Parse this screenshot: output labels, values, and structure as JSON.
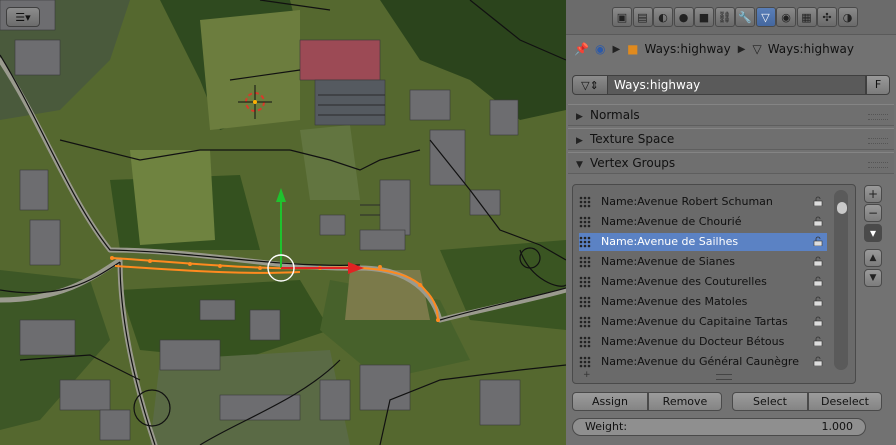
{
  "viewport": {
    "description_icons": [
      "3d-cursor-icon",
      "transform-gizmo-icon"
    ]
  },
  "properties": {
    "context_tabs": [
      {
        "name": "render-tab",
        "glyph": "▣"
      },
      {
        "name": "render-layers-tab",
        "glyph": "▤"
      },
      {
        "name": "scene-tab",
        "glyph": "◐"
      },
      {
        "name": "world-tab",
        "glyph": "●"
      },
      {
        "name": "object-tab",
        "glyph": "■"
      },
      {
        "name": "constraints-tab",
        "glyph": "⛓"
      },
      {
        "name": "modifiers-tab",
        "glyph": "🔧"
      },
      {
        "name": "data-tab",
        "glyph": "▽"
      },
      {
        "name": "material-tab",
        "glyph": "◉"
      },
      {
        "name": "texture-tab",
        "glyph": "▦"
      },
      {
        "name": "particles-tab",
        "glyph": "✣"
      },
      {
        "name": "physics-tab",
        "glyph": "◑"
      }
    ],
    "breadcrumb": {
      "object": "Ways:highway",
      "mesh": "Ways:highway"
    },
    "mesh_name": "Ways:highway",
    "fake_user": "F",
    "sections": {
      "normals": "Normals",
      "texture_space": "Texture Space",
      "vertex_groups": "Vertex Groups"
    },
    "vertex_groups": [
      "Name:Avenue Robert Schuman",
      "Name:Avenue de Chourié",
      "Name:Avenue de Sailhes",
      "Name:Avenue de Sianes",
      "Name:Avenue des Couturelles",
      "Name:Avenue des Matoles",
      "Name:Avenue du Capitaine Tartas",
      "Name:Avenue du Docteur Bétous",
      "Name:Avenue du Général Caunègre"
    ],
    "selected_index": 2,
    "side_buttons": {
      "add": "+",
      "remove": "−",
      "menu": "▾",
      "up": "▲",
      "down": "▼"
    },
    "buttons": {
      "assign": "Assign",
      "remove": "Remove",
      "select": "Select",
      "deselect": "Deselect"
    },
    "weight": {
      "label": "Weight:",
      "value": "1.000"
    },
    "colors": {
      "selection": "#5b82c4",
      "panel": "#727272",
      "active_tab": "#5a7fb8"
    }
  }
}
